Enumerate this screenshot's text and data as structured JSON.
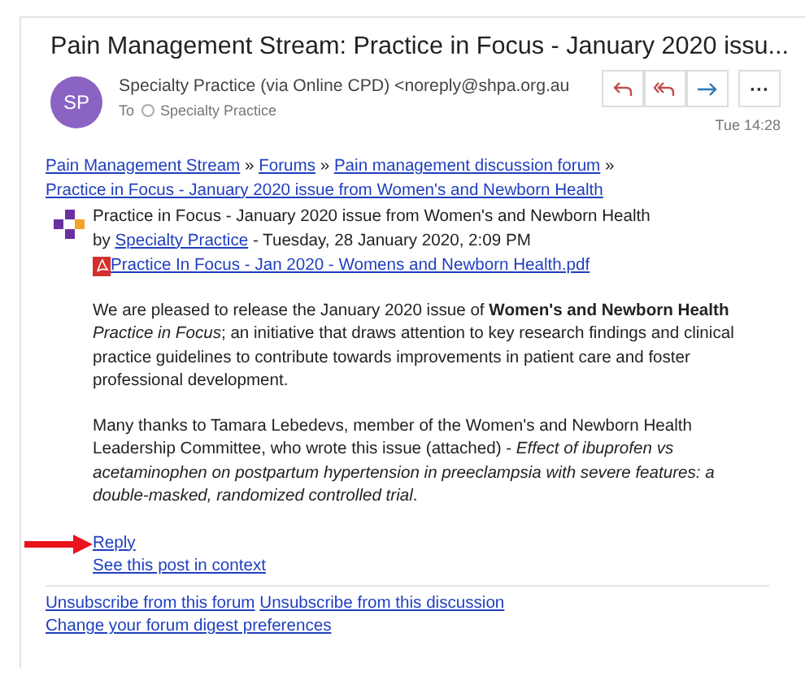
{
  "subject": "Pain Management Stream: Practice in Focus - January 2020 issu...",
  "sender": {
    "initials": "SP",
    "from": "Specialty Practice (via Online CPD) <noreply@shpa.org.au",
    "to_label": "To",
    "to": "Specialty Practice",
    "time": "Tue 14:28"
  },
  "actions": [
    {
      "kind": "reply"
    },
    {
      "kind": "reply-all"
    },
    {
      "kind": "forward"
    },
    {
      "kind": "more",
      "label": "···"
    }
  ],
  "breadcrumb": {
    "separator": "»",
    "links": [
      "Pain Management Stream",
      "Forums",
      "Pain management discussion forum",
      "Practice in Focus - January 2020 issue from Women's and Newborn Health"
    ]
  },
  "post": {
    "title": "Practice in Focus - January 2020 issue from Women's and Newborn Health",
    "by": "by",
    "author": "Specialty Practice",
    "date": "- Tuesday, 28 January 2020, 2:09 PM",
    "attachment": "Practice In Focus - Jan 2020 - Womens and Newborn Health.pdf"
  },
  "paragraphs": [
    "We are pleased to release the January 2020 issue of **Women's and Newborn Health** *Practice in Focus*; an initiative that draws attention to key research findings and clinical practice guidelines to contribute towards improvements in patient care and foster professional development.",
    "Many thanks to Tamara Lebedevs, member of the Women's and Newborn Health Leadership Committee, who wrote this issue (attached) - *Effect of ibuprofen vs acetaminophen on postpartum hypertension in preeclampsia with severe features: a double-masked, randomized controlled trial*."
  ],
  "post_links": [
    "Reply",
    "See this post in context"
  ],
  "footer_links": [
    "Unsubscribe from this forum",
    "Unsubscribe from this discussion",
    "Change your forum digest preferences"
  ]
}
